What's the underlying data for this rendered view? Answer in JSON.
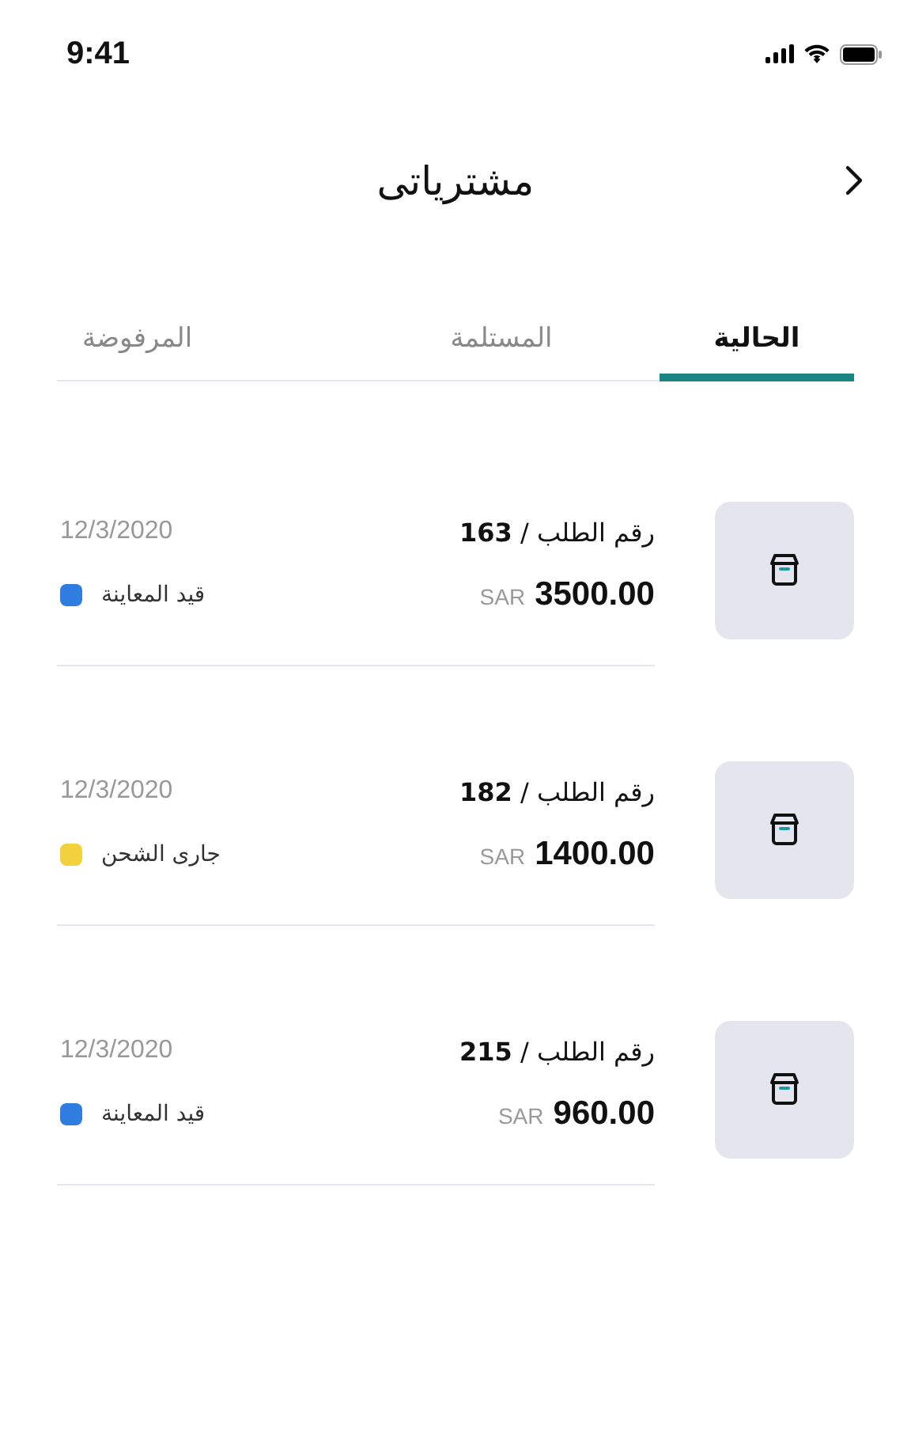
{
  "status_bar": {
    "time": "9:41"
  },
  "header": {
    "title": "مشترياتى"
  },
  "tabs": [
    {
      "label": "الحالية",
      "selected": true
    },
    {
      "label": "المستلمة",
      "selected": false
    },
    {
      "label": "المرفوضة",
      "selected": false
    }
  ],
  "orders": [
    {
      "number": "رقم الطلب / **163**",
      "amount": "3500.00",
      "currency": "SAR",
      "date": "12/3/2020",
      "status": "قيد المعاينة",
      "color": "#2f7de1"
    },
    {
      "number": "رقم الطلب / **182**",
      "amount": "1400.00",
      "currency": "SAR",
      "date": "12/3/2020",
      "status": "جارى الشحن",
      "color": "#f2d23c"
    },
    {
      "number": "رقم الطلب / **215**",
      "amount": "960.00",
      "currency": "SAR",
      "date": "12/3/2020",
      "status": "قيد المعاينة",
      "color": "#2f7de1"
    }
  ]
}
